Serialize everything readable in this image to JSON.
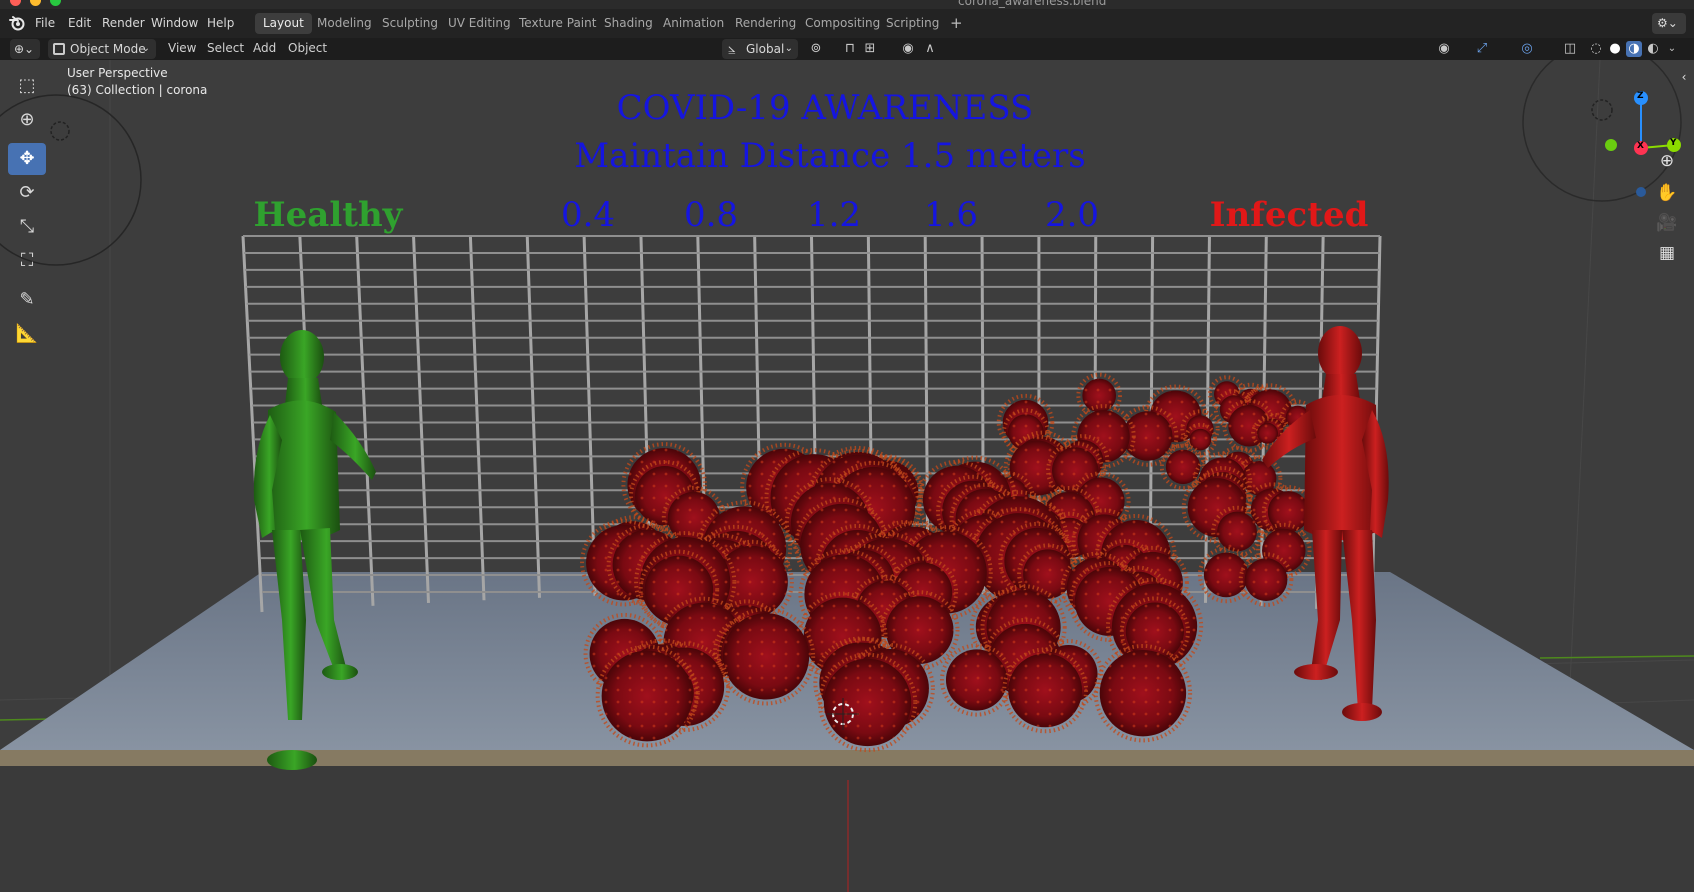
{
  "window": {
    "title": "corona_awareness.blend",
    "traffic_colors": [
      "#ff5f57",
      "#febc2e",
      "#28c840"
    ]
  },
  "menu": {
    "file": "File",
    "edit": "Edit",
    "render": "Render",
    "window": "Window",
    "help": "Help"
  },
  "workspaces": [
    "Layout",
    "Modeling",
    "Sculpting",
    "UV Editing",
    "Texture Paint",
    "Shading",
    "Animation",
    "Rendering",
    "Compositing",
    "Scripting"
  ],
  "header": {
    "mode": "Object Mode",
    "view": "View",
    "select": "Select",
    "add": "Add",
    "object": "Object",
    "orientation": "Global"
  },
  "viewport": {
    "perspective_label": "User Perspective",
    "collection_label": "(63) Collection | corona"
  },
  "scene": {
    "title": "COVID-19 AWARENESS",
    "subtitle": "Maintain Distance  1.5 meters",
    "healthy_label": "Healthy",
    "infected_label": "Infected",
    "scale_marks": [
      "0.4",
      "0.8",
      "1.2",
      "1.6",
      "2.0"
    ],
    "colors": {
      "title": "#1515e0",
      "healthy": "#2fa12f",
      "infected": "#e01818",
      "virus": "#8a0c14",
      "healthy_figure": "#2f8a1e",
      "infected_figure": "#b01818"
    }
  },
  "gizmo": {
    "x": "X",
    "y": "Y",
    "z": "Z",
    "colors": {
      "x": "#ff3352",
      "y": "#8bdc00",
      "z": "#2890ff"
    }
  },
  "icons": {
    "blender_logo": "blender-icon",
    "tools": [
      "select-box-icon",
      "cursor-icon",
      "move-icon",
      "rotate-icon",
      "scale-icon",
      "transform-icon",
      "annotate-icon",
      "measure-icon"
    ],
    "nav": [
      "zoom-icon",
      "hand-pan-icon",
      "camera-icon",
      "grid-ortho-icon"
    ]
  }
}
